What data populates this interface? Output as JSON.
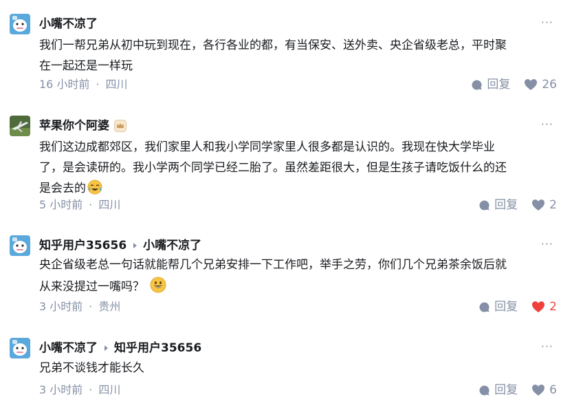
{
  "colors": {
    "meta": "#8590a6",
    "text": "#191b1f",
    "liked": "#f1403c",
    "avatar_blue": "#5aa8dc"
  },
  "comments": [
    {
      "author": "小嘴不凉了",
      "reply_to": "",
      "avatar_icon": "cartoon-avatar-icon",
      "lines": [
        "我们一帮兄弟从初中玩到现在，各行各业的都，有当保安、送外卖、央企省级老总，平时聚",
        "在一起还是一样玩"
      ],
      "time": "16 小时前",
      "location": "四川",
      "reply_label": "回复",
      "likes": "26",
      "liked": false
    },
    {
      "author": "苹果你个阿婆",
      "reply_to": "",
      "avatar_icon": "airplane-photo-avatar-icon",
      "lines": [
        "我们这边成都郊区，我们家里人和我小学同学家里人很多都是认识的。我现在快大学毕业",
        "了，是会读研的。我小学两个同学已经二胎了。虽然差距很大，但是生孩子请吃饭什么的还",
        "是会去的"
      ],
      "time": "5 小时前",
      "location": "四川",
      "reply_label": "回复",
      "likes": "2",
      "liked": false
    },
    {
      "author": "知乎用户35656",
      "reply_to": "小嘴不凉了",
      "avatar_icon": "cartoon-avatar-icon",
      "lines": [
        "央企省级老总一句话就能帮几个兄弟安排一下工作吧，举手之劳，你们几个兄弟茶余饭后就",
        "从来没提过一嘴吗？"
      ],
      "time": "3 小时前",
      "location": "贵州",
      "reply_label": "回复",
      "likes": "2",
      "liked": true
    },
    {
      "author": "小嘴不凉了",
      "reply_to": "知乎用户35656",
      "avatar_icon": "cartoon-avatar-icon",
      "lines": [
        "兄弟不谈钱才能长久"
      ],
      "time": "3 小时前",
      "location": "四川",
      "reply_label": "回复",
      "likes": "6",
      "liked": false
    }
  ]
}
